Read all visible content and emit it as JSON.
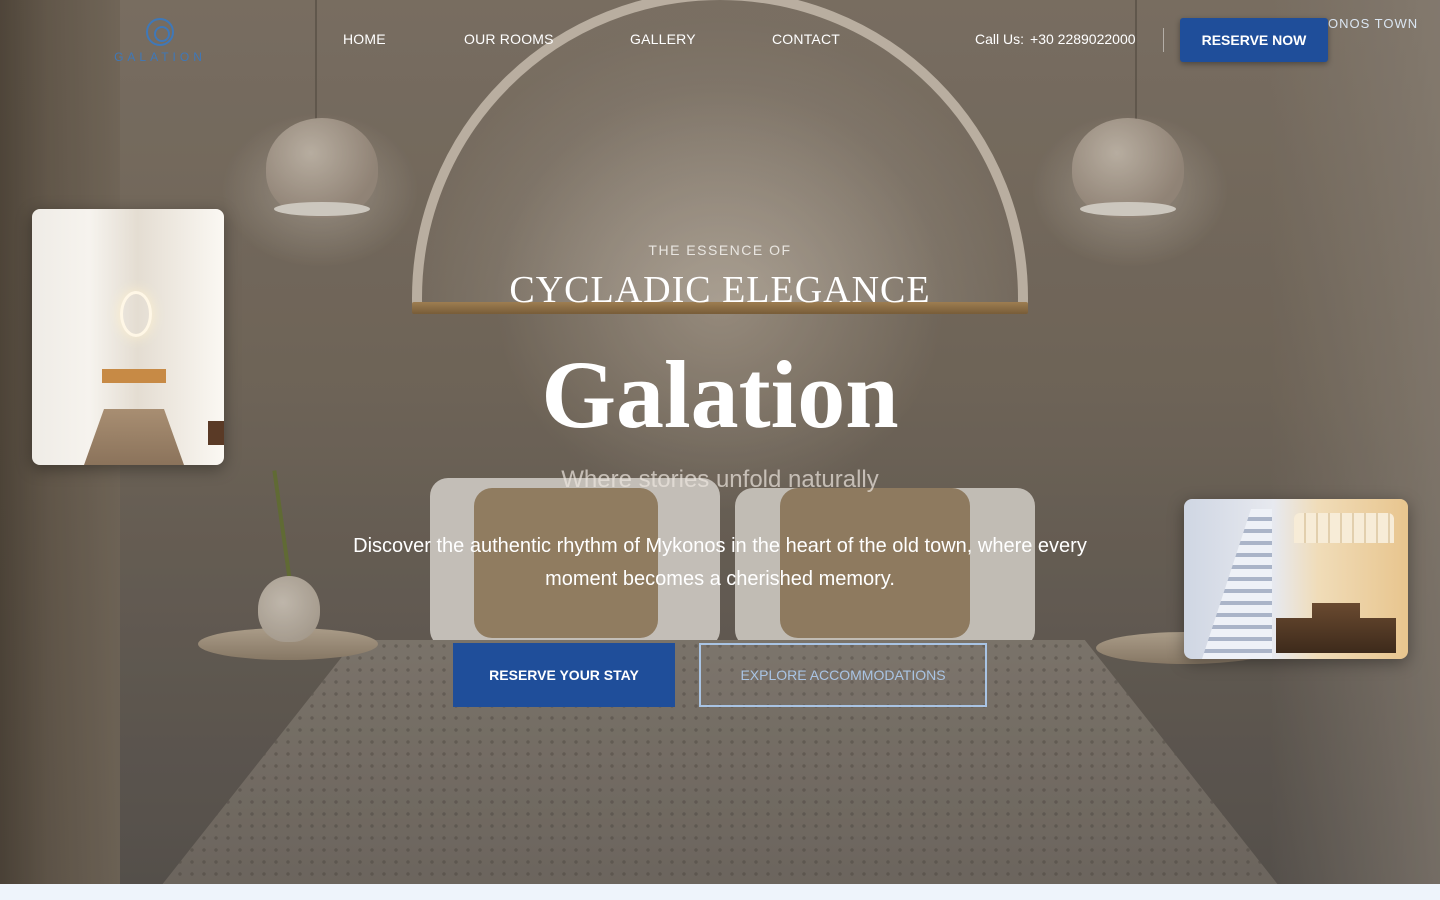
{
  "brand": {
    "logo_text": "GALATION",
    "accent_color": "#1f4e9a",
    "logo_color": "#3f78b8"
  },
  "nav": {
    "items": [
      {
        "label": "HOME"
      },
      {
        "label": "OUR ROOMS"
      },
      {
        "label": "GALLERY"
      },
      {
        "label": "CONTACT"
      }
    ],
    "call_label": "Call Us:",
    "phone": "+30 2289022000",
    "reserve_button": "RESERVE NOW",
    "location_tag": "ONOS TOWN"
  },
  "hero": {
    "eyebrow": "THE ESSENCE OF",
    "subtitle": "CYCLADIC ELEGANCE",
    "title": "Galation",
    "tagline": "Where stories unfold naturally",
    "description": "Discover the authentic rhythm of Mykonos in the heart of the old town, where every moment becomes a cherished memory.",
    "primary_button": "RESERVE YOUR STAY",
    "secondary_button": "EXPLORE ACCOMMODATIONS"
  },
  "icons": {
    "logo": "galation-spiral-logo-icon"
  }
}
